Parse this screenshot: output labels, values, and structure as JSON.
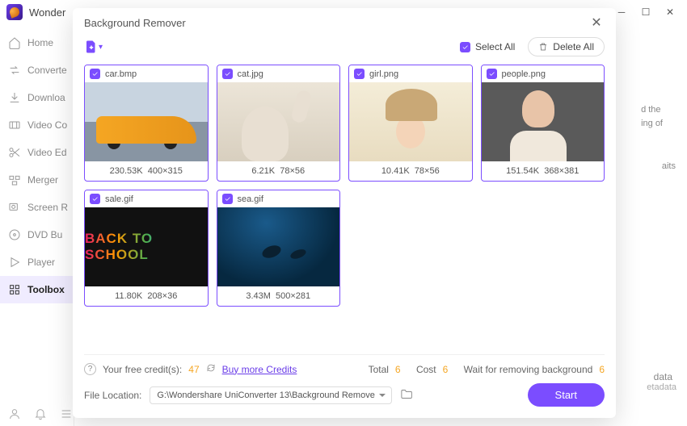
{
  "brand": "Wonder",
  "sidebar": {
    "items": [
      {
        "label": "Home"
      },
      {
        "label": "Converte"
      },
      {
        "label": "Downloa"
      },
      {
        "label": "Video Co"
      },
      {
        "label": "Video Ed"
      },
      {
        "label": "Merger"
      },
      {
        "label": "Screen R"
      },
      {
        "label": "DVD Bu"
      },
      {
        "label": "Player"
      },
      {
        "label": "Toolbox"
      }
    ]
  },
  "right_panel": {
    "line1": "d the",
    "line2": "ing of",
    "line3": "aits",
    "line4": "data",
    "line5": "etadata"
  },
  "modal": {
    "title": "Background Remover",
    "select_all": "Select All",
    "delete_all": "Delete All",
    "items": [
      {
        "filename": "car.bmp",
        "size": "230.53K",
        "dims": "400×315",
        "thumb": "car"
      },
      {
        "filename": "cat.jpg",
        "size": "6.21K",
        "dims": "78×56",
        "thumb": "cat"
      },
      {
        "filename": "girl.png",
        "size": "10.41K",
        "dims": "78×56",
        "thumb": "girl"
      },
      {
        "filename": "people.png",
        "size": "151.54K",
        "dims": "368×381",
        "thumb": "people"
      },
      {
        "filename": "sale.gif",
        "size": "11.80K",
        "dims": "208×36",
        "thumb": "sale",
        "thumb_text": "BACK TO SCHOOL"
      },
      {
        "filename": "sea.gif",
        "size": "3.43M",
        "dims": "500×281",
        "thumb": "sea"
      }
    ],
    "credits": {
      "label": "Your free credit(s):",
      "count": "47",
      "buy": "Buy more Credits",
      "total_label": "Total",
      "total": "6",
      "cost_label": "Cost",
      "cost": "6",
      "wait_label": "Wait for removing background",
      "wait": "6"
    },
    "file_location": {
      "label": "File Location:",
      "path": "G:\\Wondershare UniConverter 13\\Background Remove"
    },
    "start": "Start"
  }
}
